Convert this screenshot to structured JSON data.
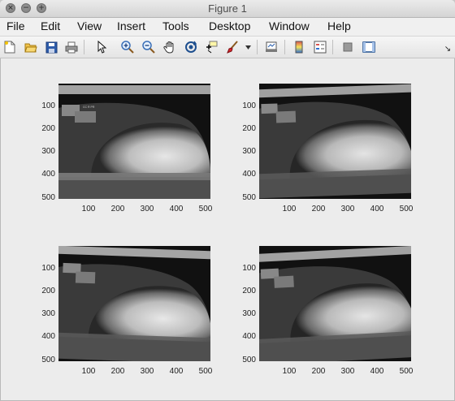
{
  "window": {
    "title": "Figure 1",
    "traffic": {
      "close": "×",
      "minimize": "−",
      "zoom": "+"
    }
  },
  "menubar": {
    "items": [
      "File",
      "Edit",
      "View",
      "Insert",
      "Tools",
      "Desktop",
      "Window",
      "Help"
    ]
  },
  "toolbar": {
    "icons": [
      "new-figure-icon",
      "open-file-icon",
      "save-icon",
      "print-icon",
      "select-arrow-icon",
      "zoom-in-icon",
      "zoom-out-icon",
      "pan-hand-icon",
      "rotate-3d-icon",
      "data-cursor-icon",
      "brush-icon",
      "dropdown-arrow-icon",
      "link-plot-icon",
      "colorbar-icon",
      "legend-icon",
      "hide-plot-tools-icon",
      "show-plot-tools-icon"
    ],
    "corner_glyph": "↘"
  },
  "axes": {
    "yticks": [
      "100",
      "200",
      "300",
      "400",
      "500"
    ],
    "xticks": [
      "100",
      "200",
      "300",
      "400",
      "500"
    ]
  }
}
